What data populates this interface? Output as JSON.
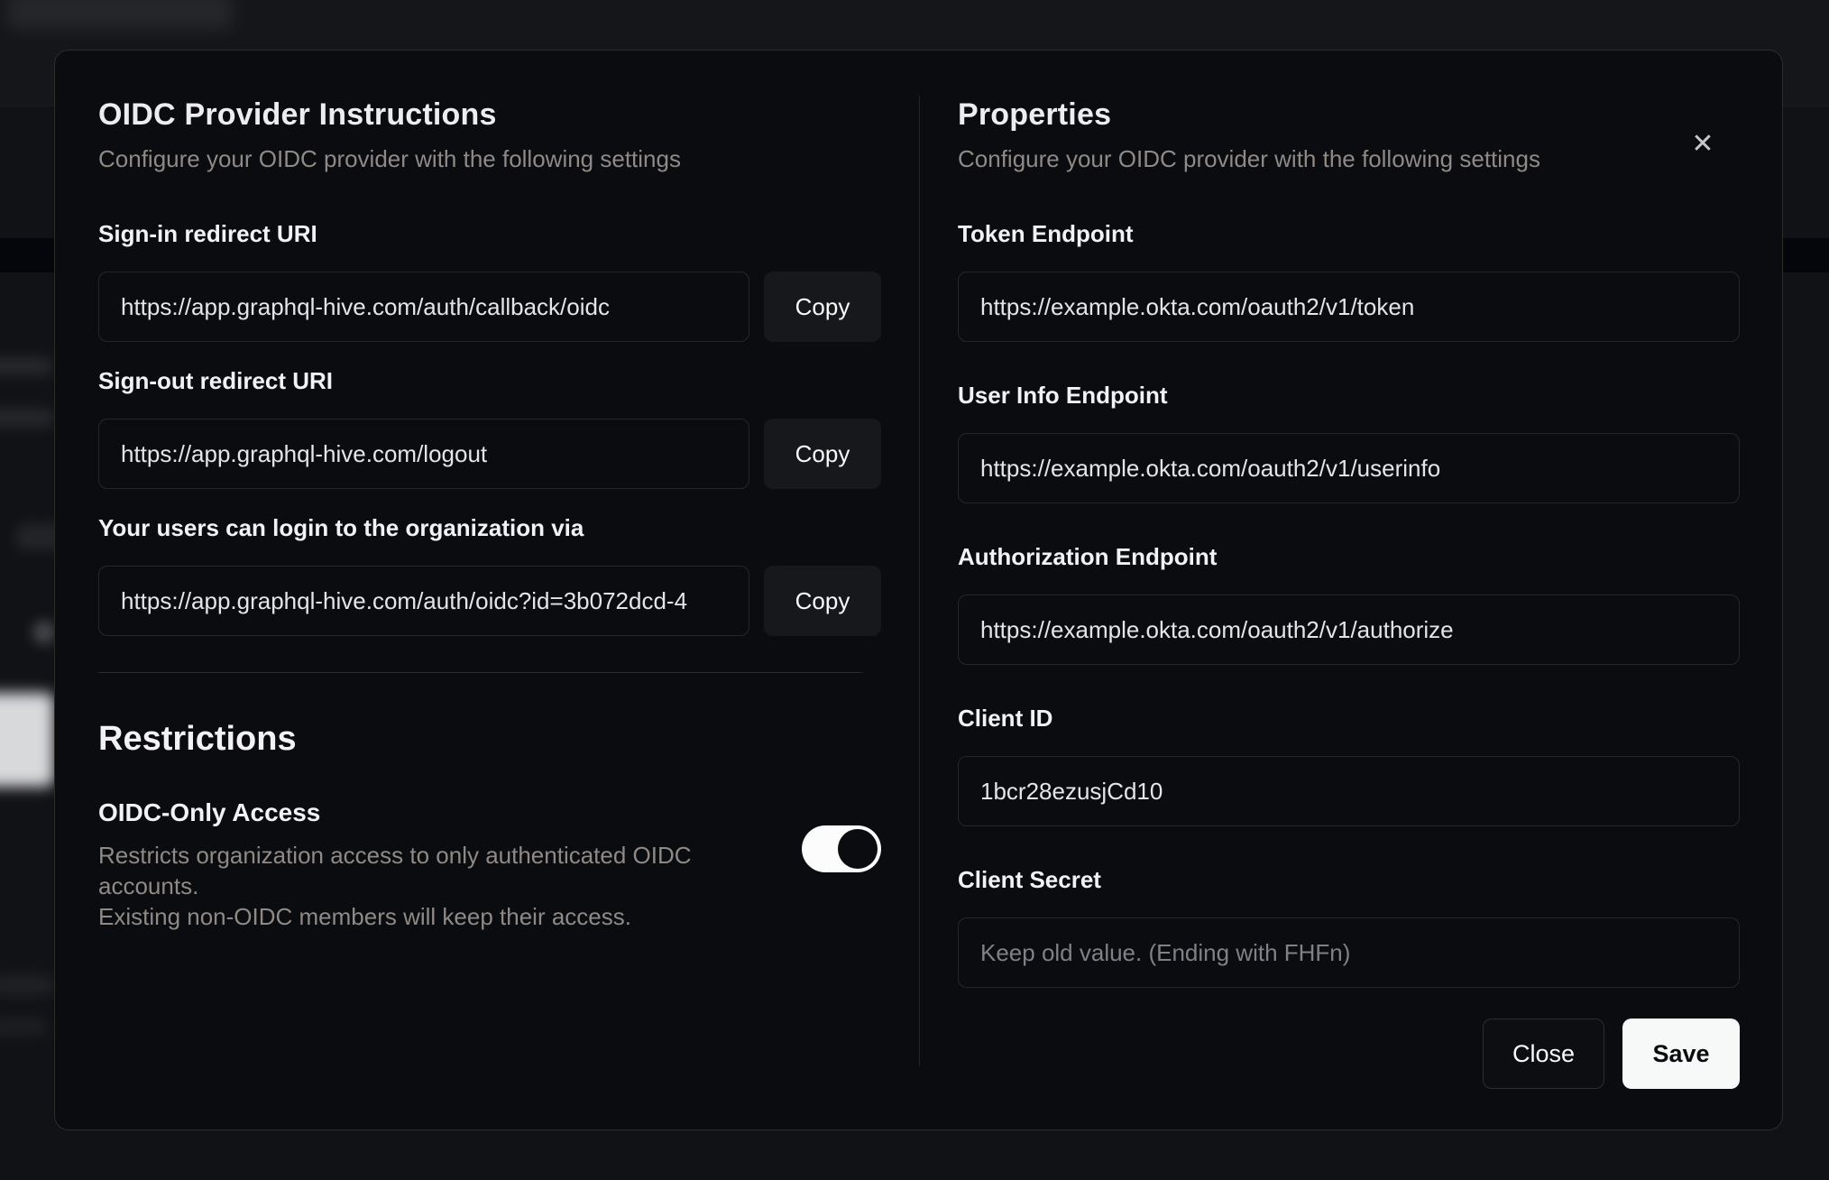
{
  "modal": {
    "close_icon": "✕",
    "left": {
      "title": "OIDC Provider Instructions",
      "subtitle": "Configure your OIDC provider with the following settings",
      "fields": [
        {
          "label": "Sign-in redirect URI",
          "value": "https://app.graphql-hive.com/auth/callback/oidc",
          "copy_label": "Copy"
        },
        {
          "label": "Sign-out redirect URI",
          "value": "https://app.graphql-hive.com/logout",
          "copy_label": "Copy"
        },
        {
          "label": "Your users can login to the organization via",
          "value": "https://app.graphql-hive.com/auth/oidc?id=3b072dcd-4",
          "copy_label": "Copy"
        }
      ],
      "restrictions": {
        "title": "Restrictions",
        "toggle_label": "OIDC-Only Access",
        "toggle_description_line1": "Restricts organization access to only authenticated OIDC accounts.",
        "toggle_description_line2": "Existing non-OIDC members will keep their access.",
        "toggle_state": "on"
      }
    },
    "right": {
      "title": "Properties",
      "subtitle": "Configure your OIDC provider with the following settings",
      "fields": [
        {
          "label": "Token Endpoint",
          "value": "https://example.okta.com/oauth2/v1/token"
        },
        {
          "label": "User Info Endpoint",
          "value": "https://example.okta.com/oauth2/v1/userinfo"
        },
        {
          "label": "Authorization Endpoint",
          "value": "https://example.okta.com/oauth2/v1/authorize"
        },
        {
          "label": "Client ID",
          "value": "1bcr28ezusjCd10"
        },
        {
          "label": "Client Secret",
          "placeholder": "Keep old value. (Ending with FHFn)"
        }
      ],
      "buttons": {
        "close": "Close",
        "save": "Save"
      }
    }
  },
  "colors": {
    "modal_background": "#0b0c0f",
    "page_background": "#111216",
    "input_border": "#27272b",
    "accent_button": "#f7f8f8",
    "toggle_on": "#fcfcfd",
    "muted_text": "#8f8a85"
  }
}
